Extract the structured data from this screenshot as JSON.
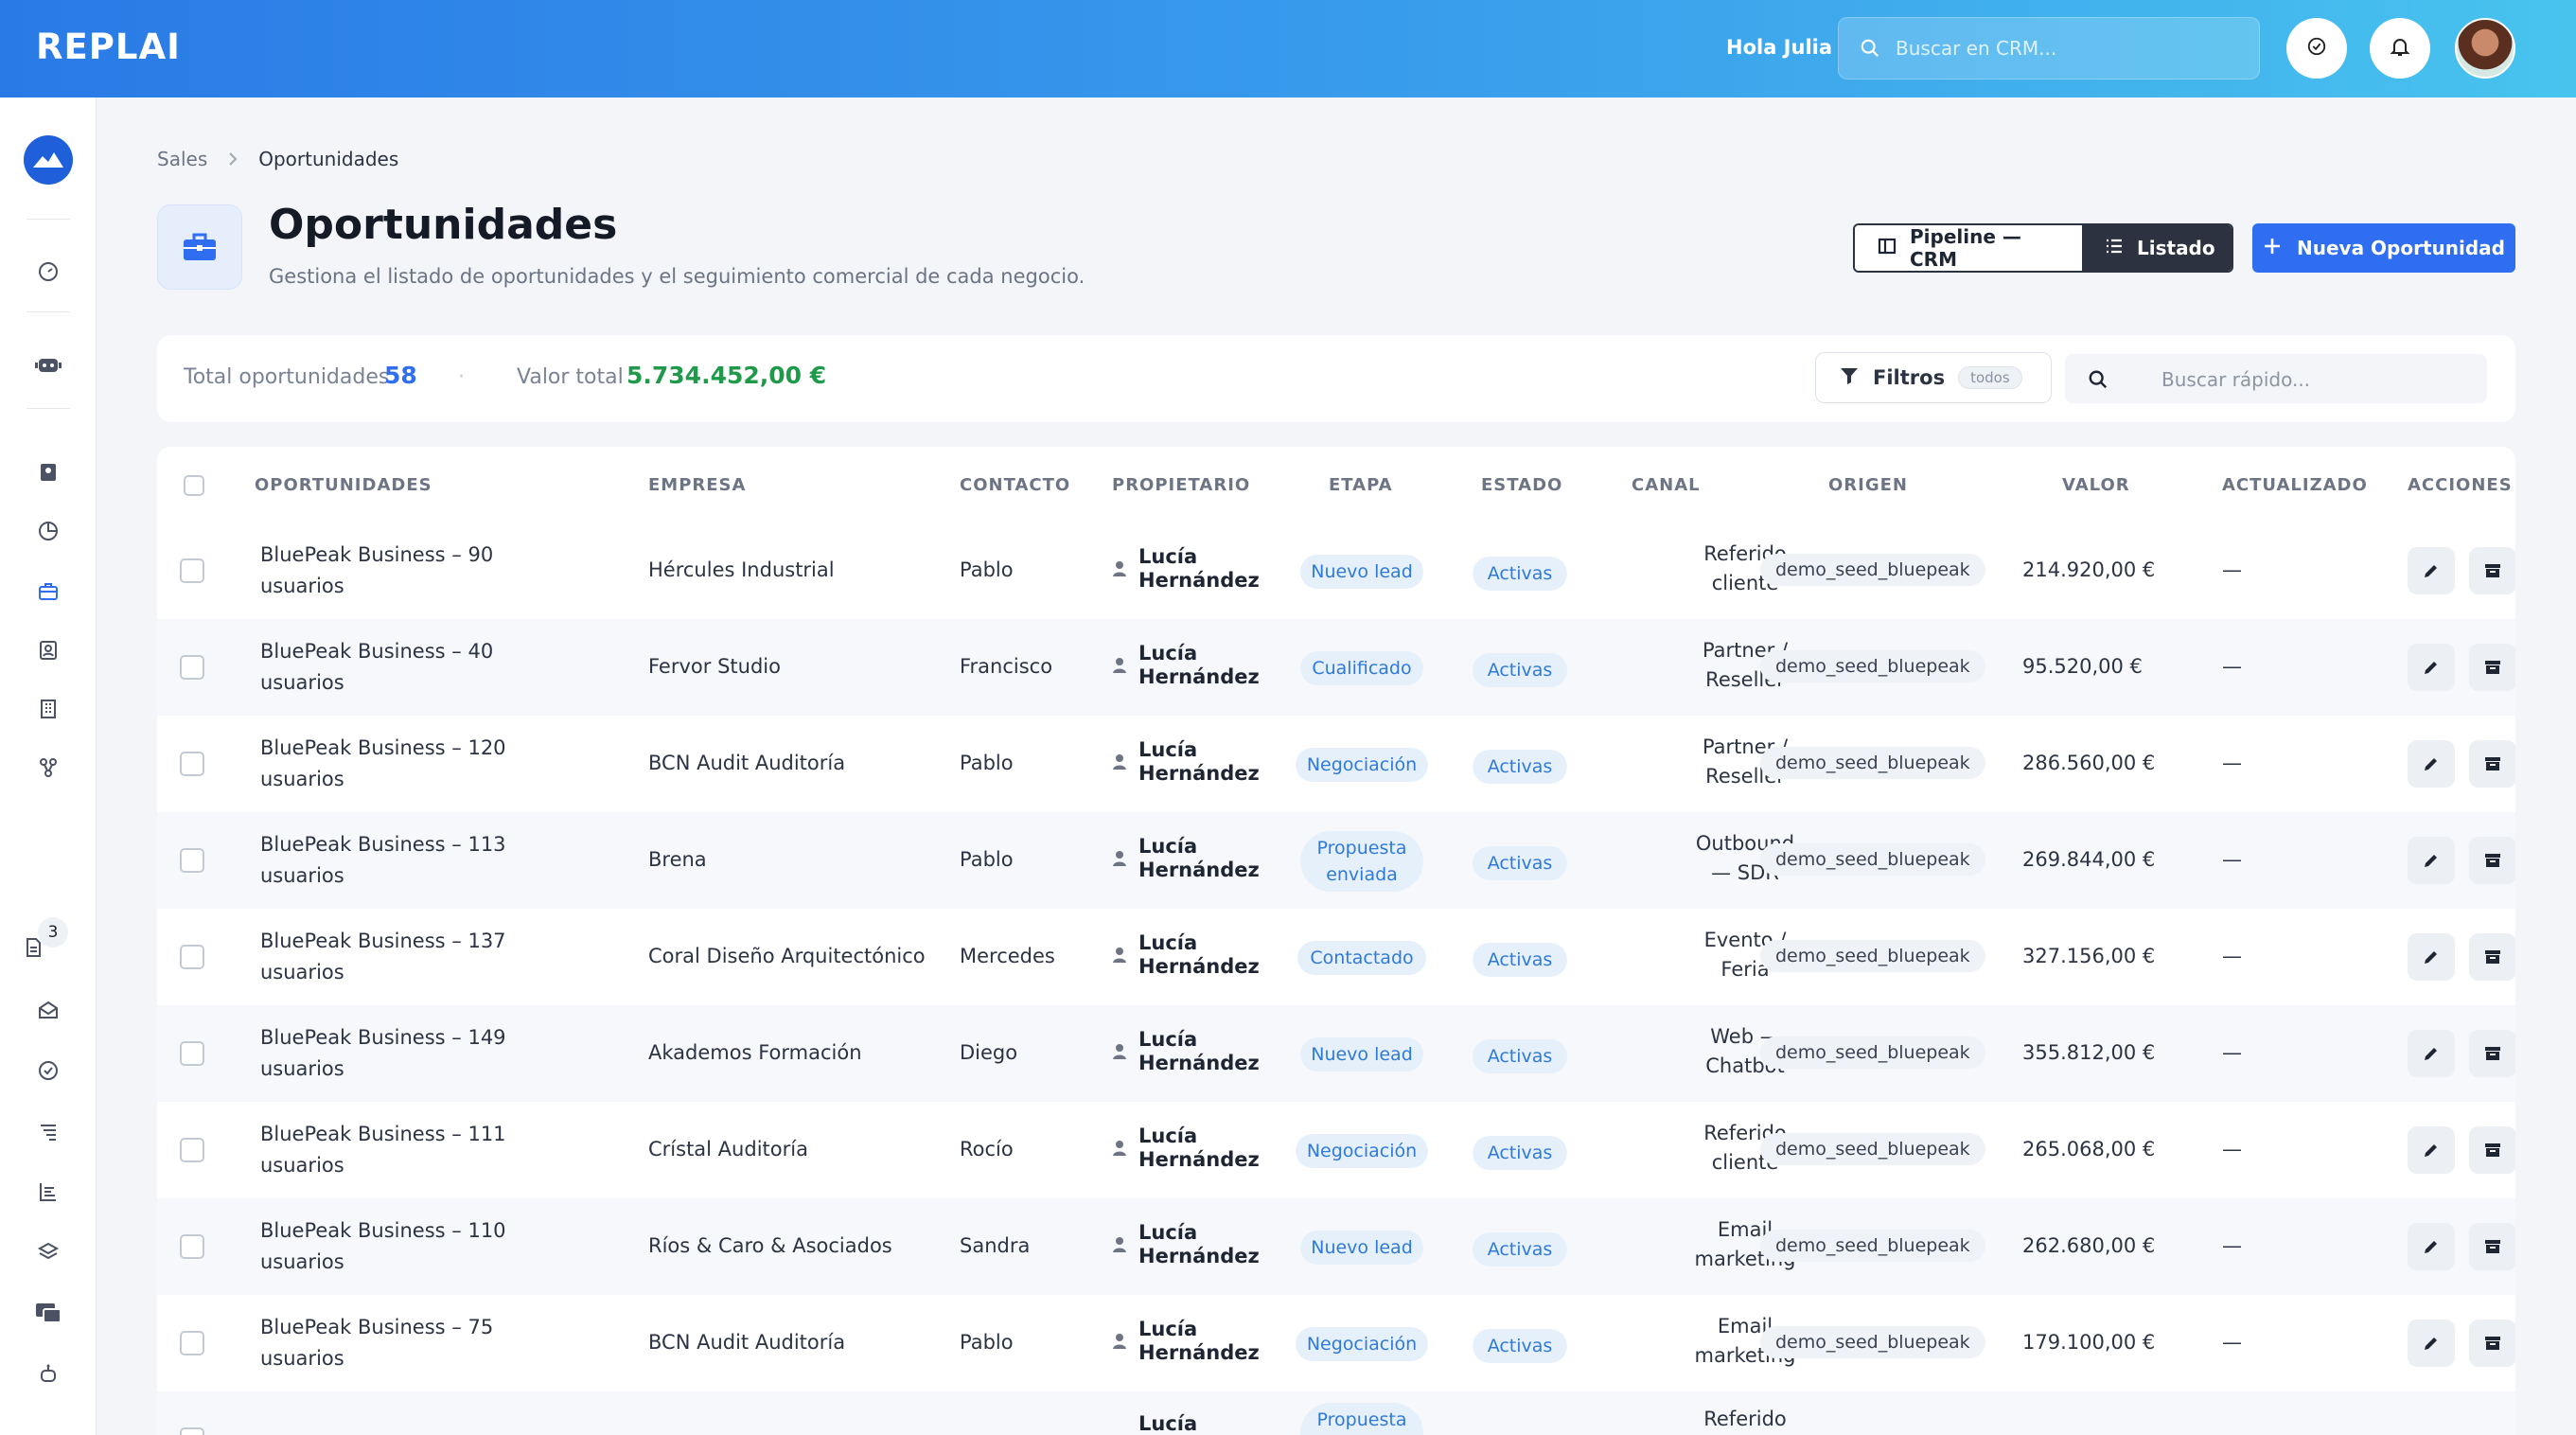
{
  "app": {
    "logo": "REPLAI",
    "greeting": "Hola Julia",
    "search_placeholder": "Buscar en CRM..."
  },
  "sidebar": {
    "badge_count": "3",
    "icons": [
      "dashboard-icon",
      "bot-icon",
      "contacts-book-icon",
      "pie-chart-icon",
      "briefcase-icon",
      "contact-card-icon",
      "building-icon",
      "integrations-icon",
      "document-icon",
      "mail-open-icon",
      "check-circle-icon",
      "list-icon",
      "report-icon",
      "layers-icon",
      "billing-icon",
      "robot-icon"
    ]
  },
  "breadcrumb": {
    "root": "Sales",
    "current": "Oportunidades"
  },
  "page": {
    "title": "Oportunidades",
    "subtitle": "Gestiona el listado de oportunidades y el seguimiento comercial de cada negocio."
  },
  "view_toggle": {
    "pipeline": "Pipeline — CRM",
    "list": "Listado",
    "active": "Listado"
  },
  "new_button": "Nueva Oportunidad",
  "stats": {
    "total_label": "Total oportunidades",
    "total_value": "58",
    "separator": "·",
    "value_label": "Valor total",
    "value_value": "5.734.452,00 €"
  },
  "filters": {
    "label": "Filtros",
    "chip": "todos"
  },
  "quick_search_placeholder": "Buscar rápido...",
  "table": {
    "headers": [
      "OPORTUNIDADES",
      "EMPRESA",
      "CONTACTO",
      "PROPIETARIO",
      "ETAPA",
      "ESTADO",
      "CANAL",
      "ORIGEN",
      "VALOR",
      "ACTUALIZADO",
      "ACCIONES"
    ],
    "rows": [
      {
        "name1": "BluePeak Business – 90",
        "name2": "usuarios",
        "company": "Hércules Industrial",
        "contact": "Pablo",
        "owner1": "Lucía",
        "owner2": "Hernández",
        "stage1": "Nuevo lead",
        "stage2": "",
        "state": "Activas",
        "canal1": "Referido",
        "canal2": "cliente",
        "origin": "demo_seed_bluepeak",
        "value": "214.920,00 €",
        "updated": "—"
      },
      {
        "name1": "BluePeak Business – 40",
        "name2": "usuarios",
        "company": "Fervor Studio",
        "contact": "Francisco",
        "owner1": "Lucía",
        "owner2": "Hernández",
        "stage1": "Cualificado",
        "stage2": "",
        "state": "Activas",
        "canal1": "Partner /",
        "canal2": "Reseller",
        "origin": "demo_seed_bluepeak",
        "value": "95.520,00 €",
        "updated": "—"
      },
      {
        "name1": "BluePeak Business – 120",
        "name2": "usuarios",
        "company": "BCN Audit Auditoría",
        "contact": "Pablo",
        "owner1": "Lucía",
        "owner2": "Hernández",
        "stage1": "Negociación",
        "stage2": "",
        "state": "Activas",
        "canal1": "Partner /",
        "canal2": "Reseller",
        "origin": "demo_seed_bluepeak",
        "value": "286.560,00 €",
        "updated": "—"
      },
      {
        "name1": "BluePeak Business – 113",
        "name2": "usuarios",
        "company": "Brena",
        "contact": "Pablo",
        "owner1": "Lucía",
        "owner2": "Hernández",
        "stage1": "Propuesta",
        "stage2": "enviada",
        "state": "Activas",
        "canal1": "Outbound",
        "canal2": "— SDR",
        "origin": "demo_seed_bluepeak",
        "value": "269.844,00 €",
        "updated": "—"
      },
      {
        "name1": "BluePeak Business – 137",
        "name2": "usuarios",
        "company": "Coral Diseño Arquitectónico",
        "contact": "Mercedes",
        "owner1": "Lucía",
        "owner2": "Hernández",
        "stage1": "Contactado",
        "stage2": "",
        "state": "Activas",
        "canal1": "Evento /",
        "canal2": "Feria",
        "origin": "demo_seed_bluepeak",
        "value": "327.156,00 €",
        "updated": "—"
      },
      {
        "name1": "BluePeak Business – 149",
        "name2": "usuarios",
        "company": "Akademos Formación",
        "contact": "Diego",
        "owner1": "Lucía",
        "owner2": "Hernández",
        "stage1": "Nuevo lead",
        "stage2": "",
        "state": "Activas",
        "canal1": "Web —",
        "canal2": "Chatbot",
        "origin": "demo_seed_bluepeak",
        "value": "355.812,00 €",
        "updated": "—"
      },
      {
        "name1": "BluePeak Business – 111",
        "name2": "usuarios",
        "company": "Crístal Auditoría",
        "contact": "Rocío",
        "owner1": "Lucía",
        "owner2": "Hernández",
        "stage1": "Negociación",
        "stage2": "",
        "state": "Activas",
        "canal1": "Referido",
        "canal2": "cliente",
        "origin": "demo_seed_bluepeak",
        "value": "265.068,00 €",
        "updated": "—"
      },
      {
        "name1": "BluePeak Business – 110",
        "name2": "usuarios",
        "company": "Ríos & Caro & Asociados",
        "contact": "Sandra",
        "owner1": "Lucía",
        "owner2": "Hernández",
        "stage1": "Nuevo lead",
        "stage2": "",
        "state": "Activas",
        "canal1": "Email",
        "canal2": "marketing",
        "origin": "demo_seed_bluepeak",
        "value": "262.680,00 €",
        "updated": "—"
      },
      {
        "name1": "BluePeak Business – 75",
        "name2": "usuarios",
        "company": "BCN Audit Auditoría",
        "contact": "Pablo",
        "owner1": "Lucía",
        "owner2": "Hernández",
        "stage1": "Negociación",
        "stage2": "",
        "state": "Activas",
        "canal1": "Email",
        "canal2": "marketing",
        "origin": "demo_seed_bluepeak",
        "value": "179.100,00 €",
        "updated": "—"
      },
      {
        "name1": "",
        "name2": "",
        "company": "",
        "contact": "",
        "owner1": "Lucía",
        "owner2": "",
        "stage1": "Propuesta",
        "stage2": "",
        "state": "",
        "canal1": "Referido",
        "canal2": "",
        "origin": "",
        "value": "",
        "updated": ""
      }
    ]
  },
  "colors": {
    "accent": "#2f6ef0",
    "green": "#1e9a4a",
    "pill_bg": "#e6f0fb",
    "pill_text": "#2f7ad9"
  }
}
